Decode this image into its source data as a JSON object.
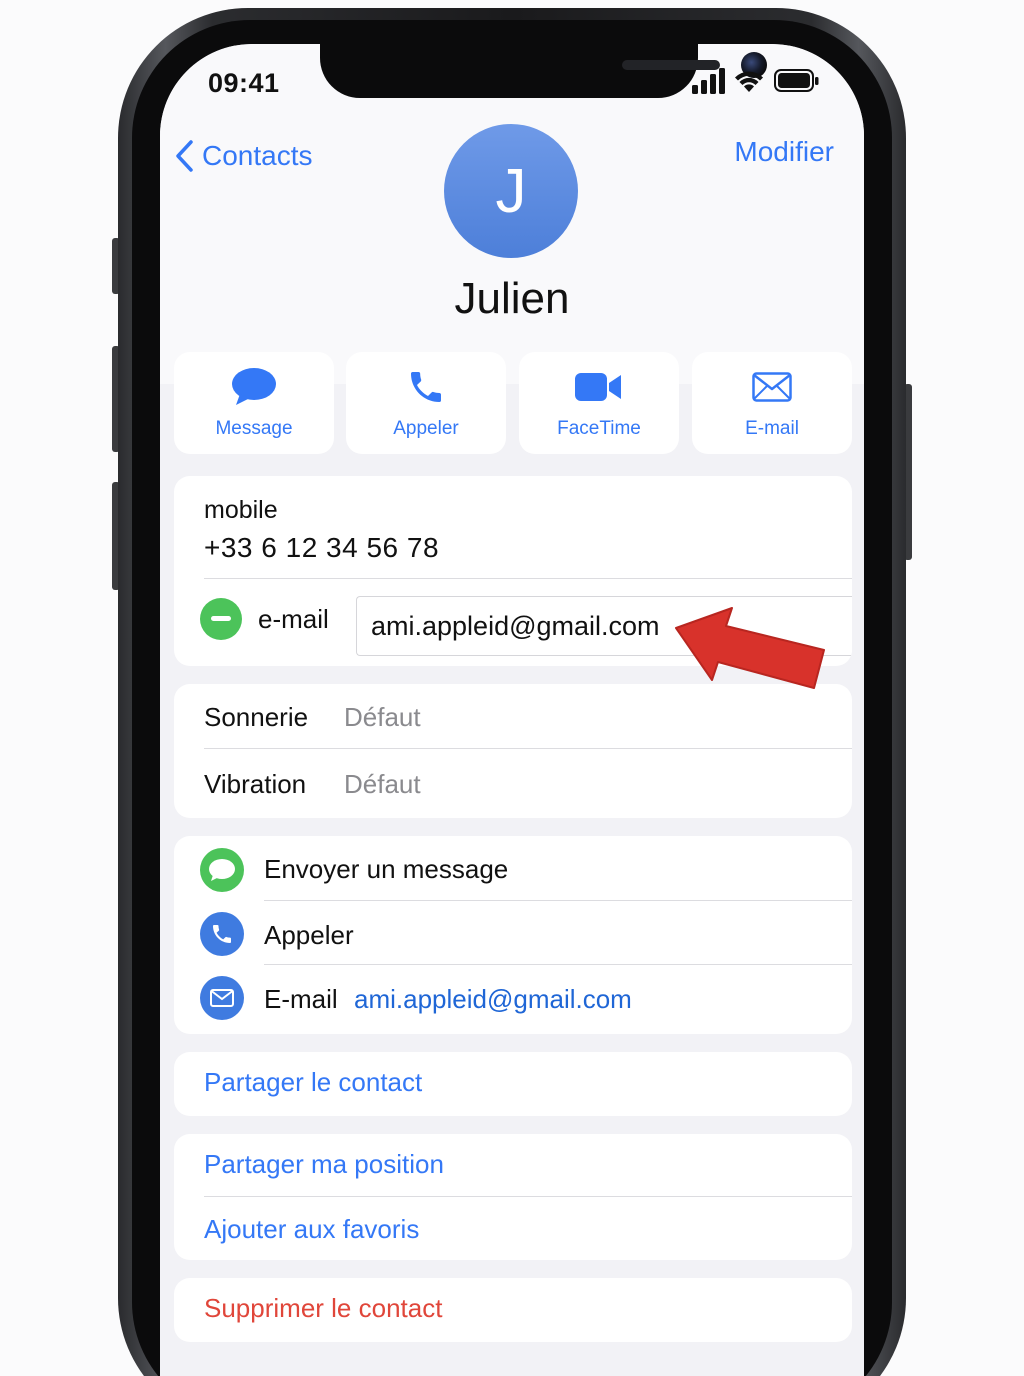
{
  "status_bar": {
    "time": "09:41",
    "icons": [
      "cellular-signal-icon",
      "wifi-icon",
      "battery-icon"
    ]
  },
  "nav": {
    "back_label": "Contacts",
    "edit_label": "Modifier"
  },
  "contact": {
    "initial": "J",
    "name": "Julien"
  },
  "actions": [
    {
      "label": "Message",
      "icon": "message-bubble-icon"
    },
    {
      "label": "Appeler",
      "icon": "phone-icon"
    },
    {
      "label": "FaceTime",
      "icon": "video-camera-icon"
    },
    {
      "label": "E-mail",
      "icon": "envelope-icon"
    }
  ],
  "phone_field": {
    "label": "mobile",
    "number": "+33 6 12 34 56 78"
  },
  "email_field": {
    "label": "e-mail",
    "value": "ami.appleid@gmail.com"
  },
  "ringtone": {
    "ring_label": "Sonnerie",
    "ring_value": "Défaut",
    "vibration_label": "Vibration",
    "vibration_value": "Défaut"
  },
  "communication": {
    "message_label": "Envoyer un message",
    "call_label": "Appeler",
    "email_label": "E-mail",
    "email_value": "ami.appleid@gmail.com"
  },
  "links": {
    "share_contact": "Partager le contact",
    "share_location": "Partager ma position",
    "add_favorites": "Ajouter aux favoris",
    "delete_contact": "Supprimer le contact"
  },
  "colors": {
    "accent": "#3478f6",
    "avatar": "#5b89de",
    "green": "#4cc35a",
    "danger": "#e0463a",
    "arrow": "#d8322b"
  }
}
